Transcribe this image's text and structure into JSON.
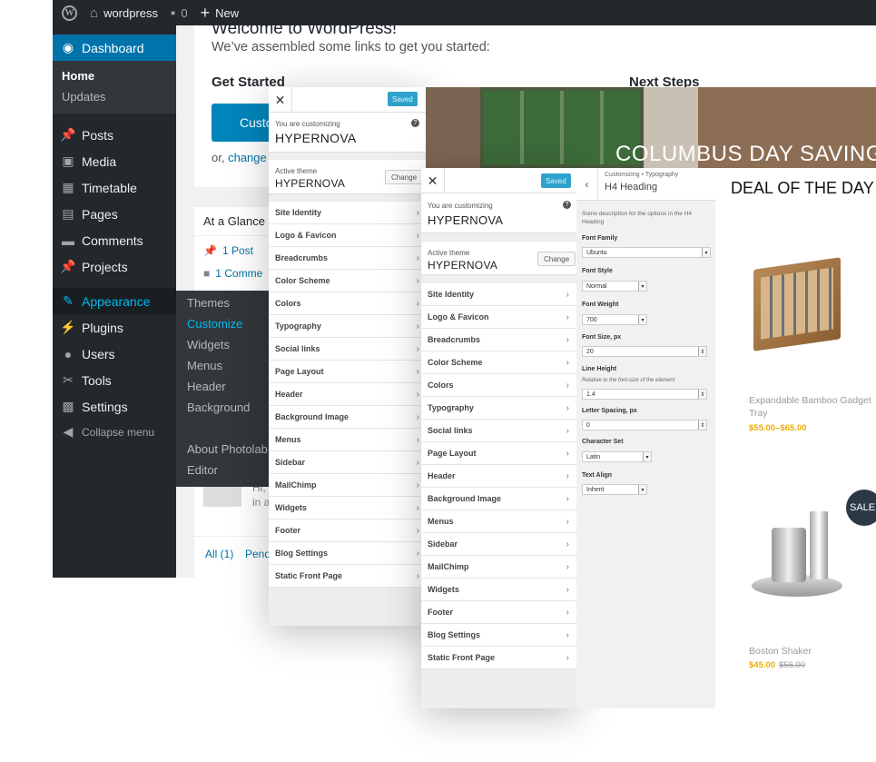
{
  "adminbar": {
    "site_name": "wordpress",
    "comments_count": "0",
    "new_label": "New"
  },
  "menu": {
    "dashboard": "Dashboard",
    "dash_sub": [
      "Home",
      "Updates"
    ],
    "items": [
      "Posts",
      "Media",
      "Timetable",
      "Pages",
      "Comments",
      "Projects"
    ],
    "appearance": "Appearance",
    "items2": [
      "Plugins",
      "Users",
      "Tools",
      "Settings"
    ],
    "collapse": "Collapse menu",
    "flyout": [
      "Themes",
      "Customize",
      "Widgets",
      "Menus",
      "Header",
      "Background",
      "About Photolab",
      "Editor"
    ]
  },
  "dashboard": {
    "welcome_title": "Welcome to WordPress!",
    "welcome_sub": "We’ve assembled some links to get you started:",
    "get_started": "Get Started",
    "customize_btn": "Custo",
    "or_text": "or,",
    "change_link": "change y",
    "next_steps": "Next Steps",
    "glance_title": "At a Glance",
    "glance_post": "1 Post",
    "glance_comment": "1 Comme",
    "comment_hi": "Hi, a",
    "comment_in": "in a",
    "all_link": "All (1)",
    "pending_link": "Pend"
  },
  "customizer1": {
    "saved": "Saved",
    "customizing_label": "You are customizing",
    "theme": "HYPERNOVA",
    "active_theme_label": "Active theme",
    "change": "Change",
    "sections": [
      "Site Identity",
      "Logo & Favicon",
      "Breadcrumbs",
      "Color Scheme",
      "Colors",
      "Typography",
      "Social links",
      "Page Layout",
      "Header",
      "Background Image",
      "Menus",
      "Sidebar",
      "MailChimp",
      "Widgets",
      "Footer",
      "Blog Settings",
      "Static Front Page"
    ]
  },
  "customizer2": {
    "saved": "Saved",
    "customizing_label": "You are customizing",
    "theme": "HYPERNOVA",
    "active_theme_label": "Active theme",
    "change": "Change",
    "sections": [
      "Site Identity",
      "Logo & Favicon",
      "Breadcrumbs",
      "Color Scheme",
      "Colors",
      "Typography",
      "Social links",
      "Page Layout",
      "Header",
      "Background Image",
      "Menus",
      "Sidebar",
      "MailChimp",
      "Widgets",
      "Footer",
      "Blog Settings",
      "Static Front Page"
    ]
  },
  "typography": {
    "breadcrumb": "Customizing • Typography",
    "title": "H4 Heading",
    "description": "Some description for the options in the H4 Heading",
    "font_family_label": "Font Family",
    "font_family": "Ubuntu",
    "font_style_label": "Font Style",
    "font_style": "Normal",
    "font_weight_label": "Font Weight",
    "font_weight": "700",
    "font_size_label": "Font Size, px",
    "font_size": "20",
    "line_height_label": "Line Height",
    "line_height_hint": "Relative to the font-size of the element",
    "line_height": "1.4",
    "letter_spacing_label": "Letter Spacing, px",
    "letter_spacing": "0",
    "charset_label": "Character Set",
    "charset": "Latin",
    "align_label": "Text Align",
    "align": "Inherit"
  },
  "store": {
    "hero_text": "COLUMBUS DAY SAVINGS",
    "deal_title": "DEAL OF THE DAY",
    "product1_name": "Expandable Bamboo Gadget Tray",
    "product1_price": "$55.00–$65.00",
    "product2_name": "Boston Shaker",
    "product2_price": "$45.00",
    "product2_old": "$56.00",
    "sale_badge": "SALE!"
  },
  "colors": {
    "wp_blue": "#0073aa",
    "admin_dark": "#23282d",
    "price_orange": "#f0ad00",
    "saved_blue": "#2ea2cc"
  }
}
